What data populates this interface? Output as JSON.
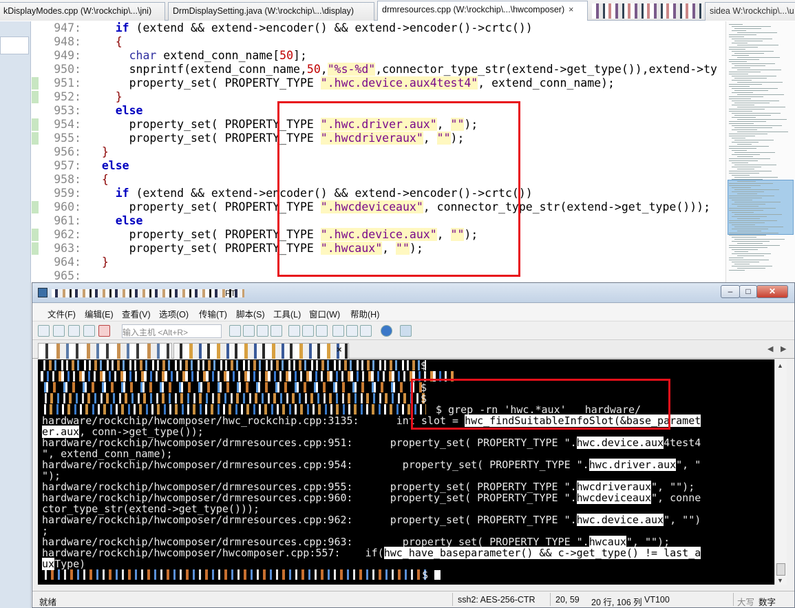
{
  "editor": {
    "tabs": [
      {
        "label": "kDisplayModes.cpp (W:\\rockchip\\...\\jni)"
      },
      {
        "label": "DrmDisplaySetting.java (W:\\rockchip\\...\\display)"
      },
      {
        "label": "drmresources.cpp (W:\\rockchip\\...\\hwcomposer)"
      },
      {
        "label": "sidea   W:\\rockchip\\...\\u"
      }
    ],
    "tab_close": "×",
    "lines": [
      {
        "n": "947:",
        "c": "    <span class=k>if</span> (extend &amp;&amp; extend-&gt;encoder() &amp;&amp; extend-&gt;encoder()-&gt;crtc())"
      },
      {
        "n": "948:",
        "c": "    <span class=p>{</span>"
      },
      {
        "n": "949:",
        "c": "      <span class=t>char</span> extend_conn_name[<span class=n>50</span>];"
      },
      {
        "n": "950:",
        "c": "      snprintf(extend_conn_name,<span class=n>50</span>,<span class=s>\"%s-%d\"</span>,connector_type_str(extend-&gt;get_type()),extend-&gt;ty"
      },
      {
        "n": "951:",
        "c": "      property_set( PROPERTY_TYPE <span class=s>\".hwc.device.aux4test4\"</span>, extend_conn_name);"
      },
      {
        "n": "952:",
        "c": "    <span class=p>}</span>"
      },
      {
        "n": "953:",
        "c": "    <span class=k>else</span>"
      },
      {
        "n": "954:",
        "c": "      property_set( PROPERTY_TYPE <span class=s>\".hwc.driver.aux\"</span>, <span class=s>\"\"</span>);"
      },
      {
        "n": "955:",
        "c": "      property_set( PROPERTY_TYPE <span class=s>\".hwcdriveraux\"</span>, <span class=s>\"\"</span>);"
      },
      {
        "n": "956:",
        "c": "  <span class=p>}</span>"
      },
      {
        "n": "957:",
        "c": "  <span class=k>else</span>"
      },
      {
        "n": "958:",
        "c": "  <span class=p>{</span>"
      },
      {
        "n": "959:",
        "c": "    <span class=k>if</span> (extend &amp;&amp; extend-&gt;encoder() &amp;&amp; extend-&gt;encoder()-&gt;crtc())"
      },
      {
        "n": "960:",
        "c": "      property_set( PROPERTY_TYPE <span class=s>\".hwcdeviceaux\"</span>, connector_type_str(extend-&gt;get_type()));"
      },
      {
        "n": "961:",
        "c": "    <span class=k>else</span>"
      },
      {
        "n": "962:",
        "c": "      property_set( PROPERTY_TYPE <span class=s>\".hwc.device.aux\"</span>, <span class=s>\"\"</span>);"
      },
      {
        "n": "963:",
        "c": "      property_set( PROPERTY_TYPE <span class=s>\".hwcaux\"</span>, <span class=s>\"\"</span>);"
      },
      {
        "n": "964:",
        "c": "  <span class=p>}</span>"
      },
      {
        "n": "965:",
        "c": ""
      }
    ]
  },
  "terminal": {
    "title": "PT",
    "window_buttons": {
      "minimize": "–",
      "maximize": "□",
      "close": "✕"
    },
    "menu": [
      "文件(F)",
      "编辑(E)",
      "查看(V)",
      "选项(O)",
      "传输(T)",
      "脚本(S)",
      "工具(L)",
      "窗口(W)",
      "帮助(H)"
    ],
    "host_placeholder": "输入主机 <Alt+R>",
    "tab_close": "×",
    "lines": [
      {
        "t": "$"
      },
      {
        "t": ""
      },
      {
        "t": "$"
      },
      {
        "t": "$"
      },
      {
        "h": "$ grep -rn 'hwc.*aux'   hardware/"
      },
      {
        "t": "hardware/rockchip/hwcomposer/hwc_rockchip.cpp:3135:      int slot = <span class=hl>hwc_findSuitableInfoSlot(&amp;base_paramet</span>"
      },
      {
        "t": "<span class=hl>er.aux</span>, conn-&gt;get_type());"
      },
      {
        "t": "hardware/rockchip/hwcomposer/drmresources.cpp:951:      property_set( PROPERTY_TYPE \".<span class=hl>hwc.device.aux</span>4test4"
      },
      {
        "t": "\", extend_conn_name);"
      },
      {
        "t": "hardware/rockchip/hwcomposer/drmresources.cpp:954:        property_set( PROPERTY_TYPE \".<span class=hl>hwc.driver.aux</span>\", \""
      },
      {
        "t": "\");"
      },
      {
        "t": "hardware/rockchip/hwcomposer/drmresources.cpp:955:      property_set( PROPERTY_TYPE \".<span class=hl>hwcdriveraux</span>\", \"\");"
      },
      {
        "t": "hardware/rockchip/hwcomposer/drmresources.cpp:960:      property_set( PROPERTY_TYPE \".<span class=hl>hwcdeviceaux</span>\", conne"
      },
      {
        "t": "ctor_type_str(extend-&gt;get_type()));"
      },
      {
        "t": "hardware/rockchip/hwcomposer/drmresources.cpp:962:      property_set( PROPERTY_TYPE \".<span class=hl>hwc.device.aux</span>\", \"\")"
      },
      {
        "t": ";"
      },
      {
        "t": "hardware/rockchip/hwcomposer/drmresources.cpp:963:        property_set( PROPERTY_TYPE \".<span class=hl>hwcaux</span>\", \"\");"
      },
      {
        "t": "hardware/rockchip/hwcomposer/hwcomposer.cpp:557:    if(<span class=hl>hwc_have_baseparameter() &amp;&amp; c-&gt;get_type() != last_a</span>"
      },
      {
        "t": "<span class=hl>ux</span>Type)"
      },
      {
        "t": "$ <span class=cursor></span>"
      }
    ],
    "status": {
      "ready": "就绪",
      "cipher": "ssh2: AES-256-CTR",
      "cursor_pos": "20,  59",
      "rows_cols": "20 行, 106 列",
      "term_type": "VT100",
      "caps": "大写",
      "num": "数字"
    }
  },
  "colors": {
    "highlight_box": "#e8101a",
    "terminal_bg": "#000000",
    "string_bg": "#fff8c0"
  }
}
